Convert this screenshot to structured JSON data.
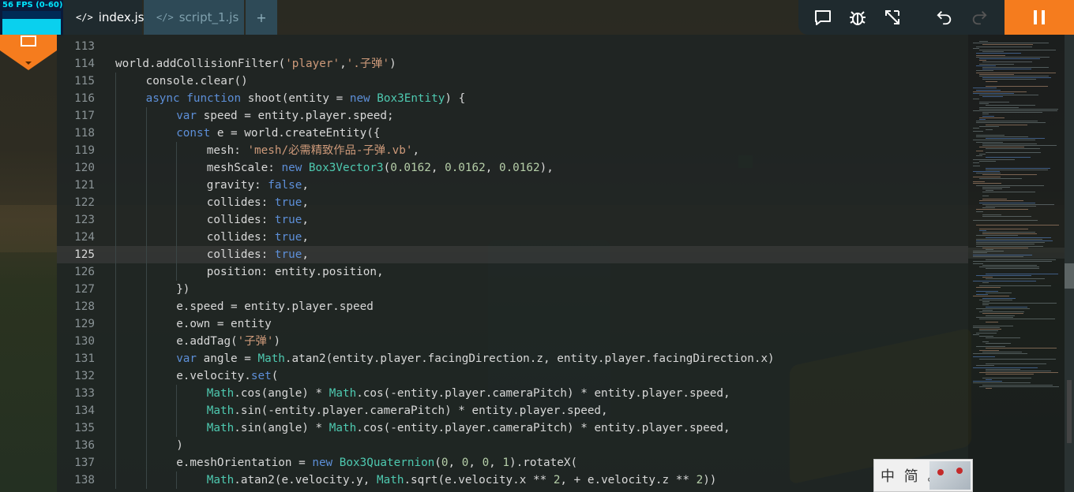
{
  "fps": {
    "label": "56 FPS (0-60)"
  },
  "tabs": [
    {
      "label": "index.js",
      "active": true
    },
    {
      "label": "script_1.js",
      "active": false
    },
    {
      "label": "+",
      "active": false
    }
  ],
  "toolbar": {
    "icons": [
      "comment-icon",
      "bug-icon",
      "expand-icon",
      "undo-icon",
      "redo-icon"
    ],
    "pause_icon": "pause-icon"
  },
  "colors": {
    "accent": "#f57c1e",
    "keyword": "#5d8fd8",
    "string": "#ce9a7a",
    "class": "#4ec9b0",
    "number": "#b5cea8"
  },
  "editor": {
    "current_line": 125,
    "lines": [
      {
        "n": "113",
        "indent": 0,
        "parts": []
      },
      {
        "n": "114",
        "indent": 0,
        "parts": [
          [
            "",
            "world.addCollisionFilter("
          ],
          [
            "str",
            "'player'"
          ],
          [
            "",
            ","
          ],
          [
            "str",
            "'.子弹'"
          ],
          [
            "",
            ")"
          ]
        ]
      },
      {
        "n": "115",
        "indent": 1,
        "parts": [
          [
            "",
            "console.clear()"
          ]
        ]
      },
      {
        "n": "116",
        "indent": 1,
        "parts": [
          [
            "kw",
            "async function"
          ],
          [
            "",
            " shoot(entity = "
          ],
          [
            "kw",
            "new"
          ],
          [
            "cls",
            " Box3Entity"
          ],
          [
            "",
            ") {"
          ]
        ]
      },
      {
        "n": "117",
        "indent": 2,
        "parts": [
          [
            "kw",
            "var"
          ],
          [
            "",
            " speed = entity.player.speed;"
          ]
        ]
      },
      {
        "n": "118",
        "indent": 2,
        "parts": [
          [
            "kw",
            "const"
          ],
          [
            "",
            " e = world.createEntity({"
          ]
        ]
      },
      {
        "n": "119",
        "indent": 3,
        "parts": [
          [
            "",
            "mesh: "
          ],
          [
            "str",
            "'mesh/必需精致作品-子弹.vb'"
          ],
          [
            "",
            ","
          ]
        ]
      },
      {
        "n": "120",
        "indent": 3,
        "parts": [
          [
            "",
            "meshScale: "
          ],
          [
            "kw",
            "new"
          ],
          [
            "cls",
            " Box3Vector3"
          ],
          [
            "",
            "("
          ],
          [
            "num",
            "0.0162"
          ],
          [
            "",
            ", "
          ],
          [
            "num",
            "0.0162"
          ],
          [
            "",
            ", "
          ],
          [
            "num",
            "0.0162"
          ],
          [
            "",
            "),"
          ]
        ]
      },
      {
        "n": "121",
        "indent": 3,
        "parts": [
          [
            "",
            "gravity: "
          ],
          [
            "kw",
            "false"
          ],
          [
            "",
            ","
          ]
        ]
      },
      {
        "n": "122",
        "indent": 3,
        "parts": [
          [
            "",
            "collides: "
          ],
          [
            "kw",
            "true"
          ],
          [
            "",
            ","
          ]
        ]
      },
      {
        "n": "123",
        "indent": 3,
        "parts": [
          [
            "",
            "collides: "
          ],
          [
            "kw",
            "true"
          ],
          [
            "",
            ","
          ]
        ]
      },
      {
        "n": "124",
        "indent": 3,
        "parts": [
          [
            "",
            "collides: "
          ],
          [
            "kw",
            "true"
          ],
          [
            "",
            ","
          ]
        ]
      },
      {
        "n": "125",
        "indent": 3,
        "parts": [
          [
            "",
            "collides: "
          ],
          [
            "kw",
            "true"
          ],
          [
            "",
            ","
          ]
        ]
      },
      {
        "n": "126",
        "indent": 3,
        "parts": [
          [
            "",
            "position: entity.position,"
          ]
        ]
      },
      {
        "n": "127",
        "indent": 2,
        "parts": [
          [
            "",
            "})"
          ]
        ]
      },
      {
        "n": "128",
        "indent": 2,
        "parts": [
          [
            "",
            "e.speed = entity.player.speed"
          ]
        ]
      },
      {
        "n": "129",
        "indent": 2,
        "parts": [
          [
            "",
            "e.own = entity"
          ]
        ]
      },
      {
        "n": "130",
        "indent": 2,
        "parts": [
          [
            "",
            "e.addTag("
          ],
          [
            "str",
            "'子弹'"
          ],
          [
            "",
            ")"
          ]
        ]
      },
      {
        "n": "131",
        "indent": 2,
        "parts": [
          [
            "kw",
            "var"
          ],
          [
            "",
            " angle = "
          ],
          [
            "cls",
            "Math"
          ],
          [
            "",
            ".atan2(entity.player.facingDirection.z, entity.player.facingDirection.x)"
          ]
        ]
      },
      {
        "n": "132",
        "indent": 2,
        "parts": [
          [
            "",
            "e.velocity."
          ],
          [
            "kw",
            "set"
          ],
          [
            "",
            "("
          ]
        ]
      },
      {
        "n": "133",
        "indent": 3,
        "parts": [
          [
            "cls",
            "Math"
          ],
          [
            "",
            ".cos(angle) * "
          ],
          [
            "cls",
            "Math"
          ],
          [
            "",
            ".cos(-entity.player.cameraPitch) * entity.player.speed,"
          ]
        ]
      },
      {
        "n": "134",
        "indent": 3,
        "parts": [
          [
            "cls",
            "Math"
          ],
          [
            "",
            ".sin(-entity.player.cameraPitch) * entity.player.speed,"
          ]
        ]
      },
      {
        "n": "135",
        "indent": 3,
        "parts": [
          [
            "cls",
            "Math"
          ],
          [
            "",
            ".sin(angle) * "
          ],
          [
            "cls",
            "Math"
          ],
          [
            "",
            ".cos(-entity.player.cameraPitch) * entity.player.speed,"
          ]
        ]
      },
      {
        "n": "136",
        "indent": 2,
        "parts": [
          [
            "",
            ")"
          ]
        ]
      },
      {
        "n": "137",
        "indent": 2,
        "parts": [
          [
            "",
            "e.meshOrientation = "
          ],
          [
            "kw",
            "new"
          ],
          [
            "cls",
            " Box3Quaternion"
          ],
          [
            "",
            "("
          ],
          [
            "num",
            "0"
          ],
          [
            "",
            ", "
          ],
          [
            "num",
            "0"
          ],
          [
            "",
            ", "
          ],
          [
            "num",
            "0"
          ],
          [
            "",
            ", "
          ],
          [
            "num",
            "1"
          ],
          [
            "",
            ").rotateX("
          ]
        ]
      },
      {
        "n": "138",
        "indent": 3,
        "parts": [
          [
            "cls",
            "Math"
          ],
          [
            "",
            ".atan2(e.velocity.y, "
          ],
          [
            "cls",
            "Math"
          ],
          [
            "",
            ".sqrt(e.velocity.x ** "
          ],
          [
            "num",
            "2"
          ],
          [
            "",
            ", + e.velocity.z ** "
          ],
          [
            "num",
            "2"
          ],
          [
            "",
            "))"
          ]
        ]
      }
    ]
  },
  "ime": {
    "label": "中 简 。"
  }
}
